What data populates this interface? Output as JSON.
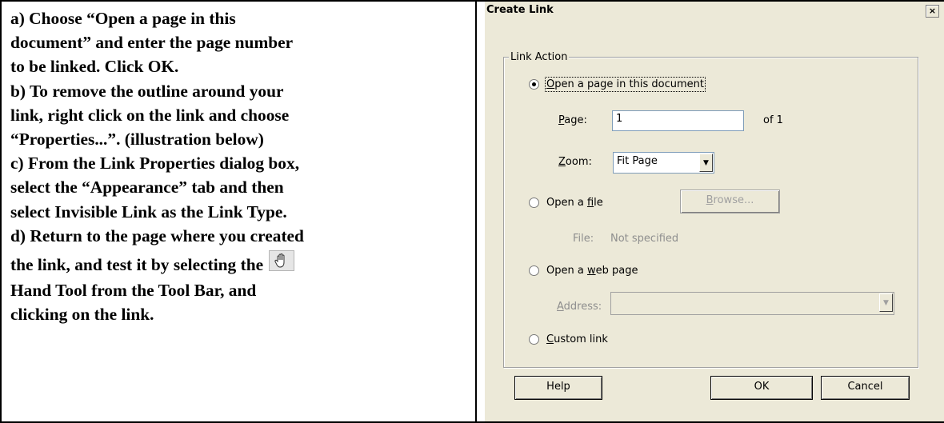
{
  "instructions": {
    "lines": [
      "a) Choose “Open a page in this",
      "document” and enter the page number",
      "to be linked. Click OK.",
      "b) To remove the outline around your",
      "link, right click on the link and choose",
      "“Properties...”. (illustration below)",
      "c) From the Link Properties dialog box,",
      "select the “Appearance” tab and then",
      "select Invisible Link as the Link Type.",
      "d) Return to the page where you created",
      "the link, and test it by selecting the",
      "Hand Tool from the Tool Bar, and",
      "clicking on the link."
    ],
    "hand_tool_icon": "hand-icon"
  },
  "dialog": {
    "title": "Create Link",
    "close_glyph": "×",
    "group_label": "Link Action",
    "options": {
      "page": {
        "pre": "",
        "key": "O",
        "post": "pen a page in this document",
        "selected": true
      },
      "file": {
        "pre": "Open a ",
        "key": "f",
        "post": "ile",
        "selected": false
      },
      "web": {
        "pre": "Open a ",
        "key": "w",
        "post": "eb page",
        "selected": false
      },
      "custom": {
        "pre": "",
        "key": "C",
        "post": "ustom link",
        "selected": false
      }
    },
    "page_field": {
      "key": "P",
      "label_rest": "age:",
      "value": "1",
      "of_text": "of 1"
    },
    "zoom_field": {
      "key": "Z",
      "label_rest": "oom:",
      "value": "Fit Page"
    },
    "browse_button": {
      "key": "B",
      "rest": "rowse..."
    },
    "file_field": {
      "label": "File:",
      "value": "Not specified"
    },
    "address_field": {
      "key": "A",
      "label_rest": "ddress:",
      "value": ""
    },
    "buttons": {
      "help": "Help",
      "ok": "OK",
      "cancel": "Cancel"
    },
    "colors": {
      "face": "#ece9d8",
      "disabled_text": "#8e8e8e",
      "input_border": "#7f9db9"
    }
  }
}
